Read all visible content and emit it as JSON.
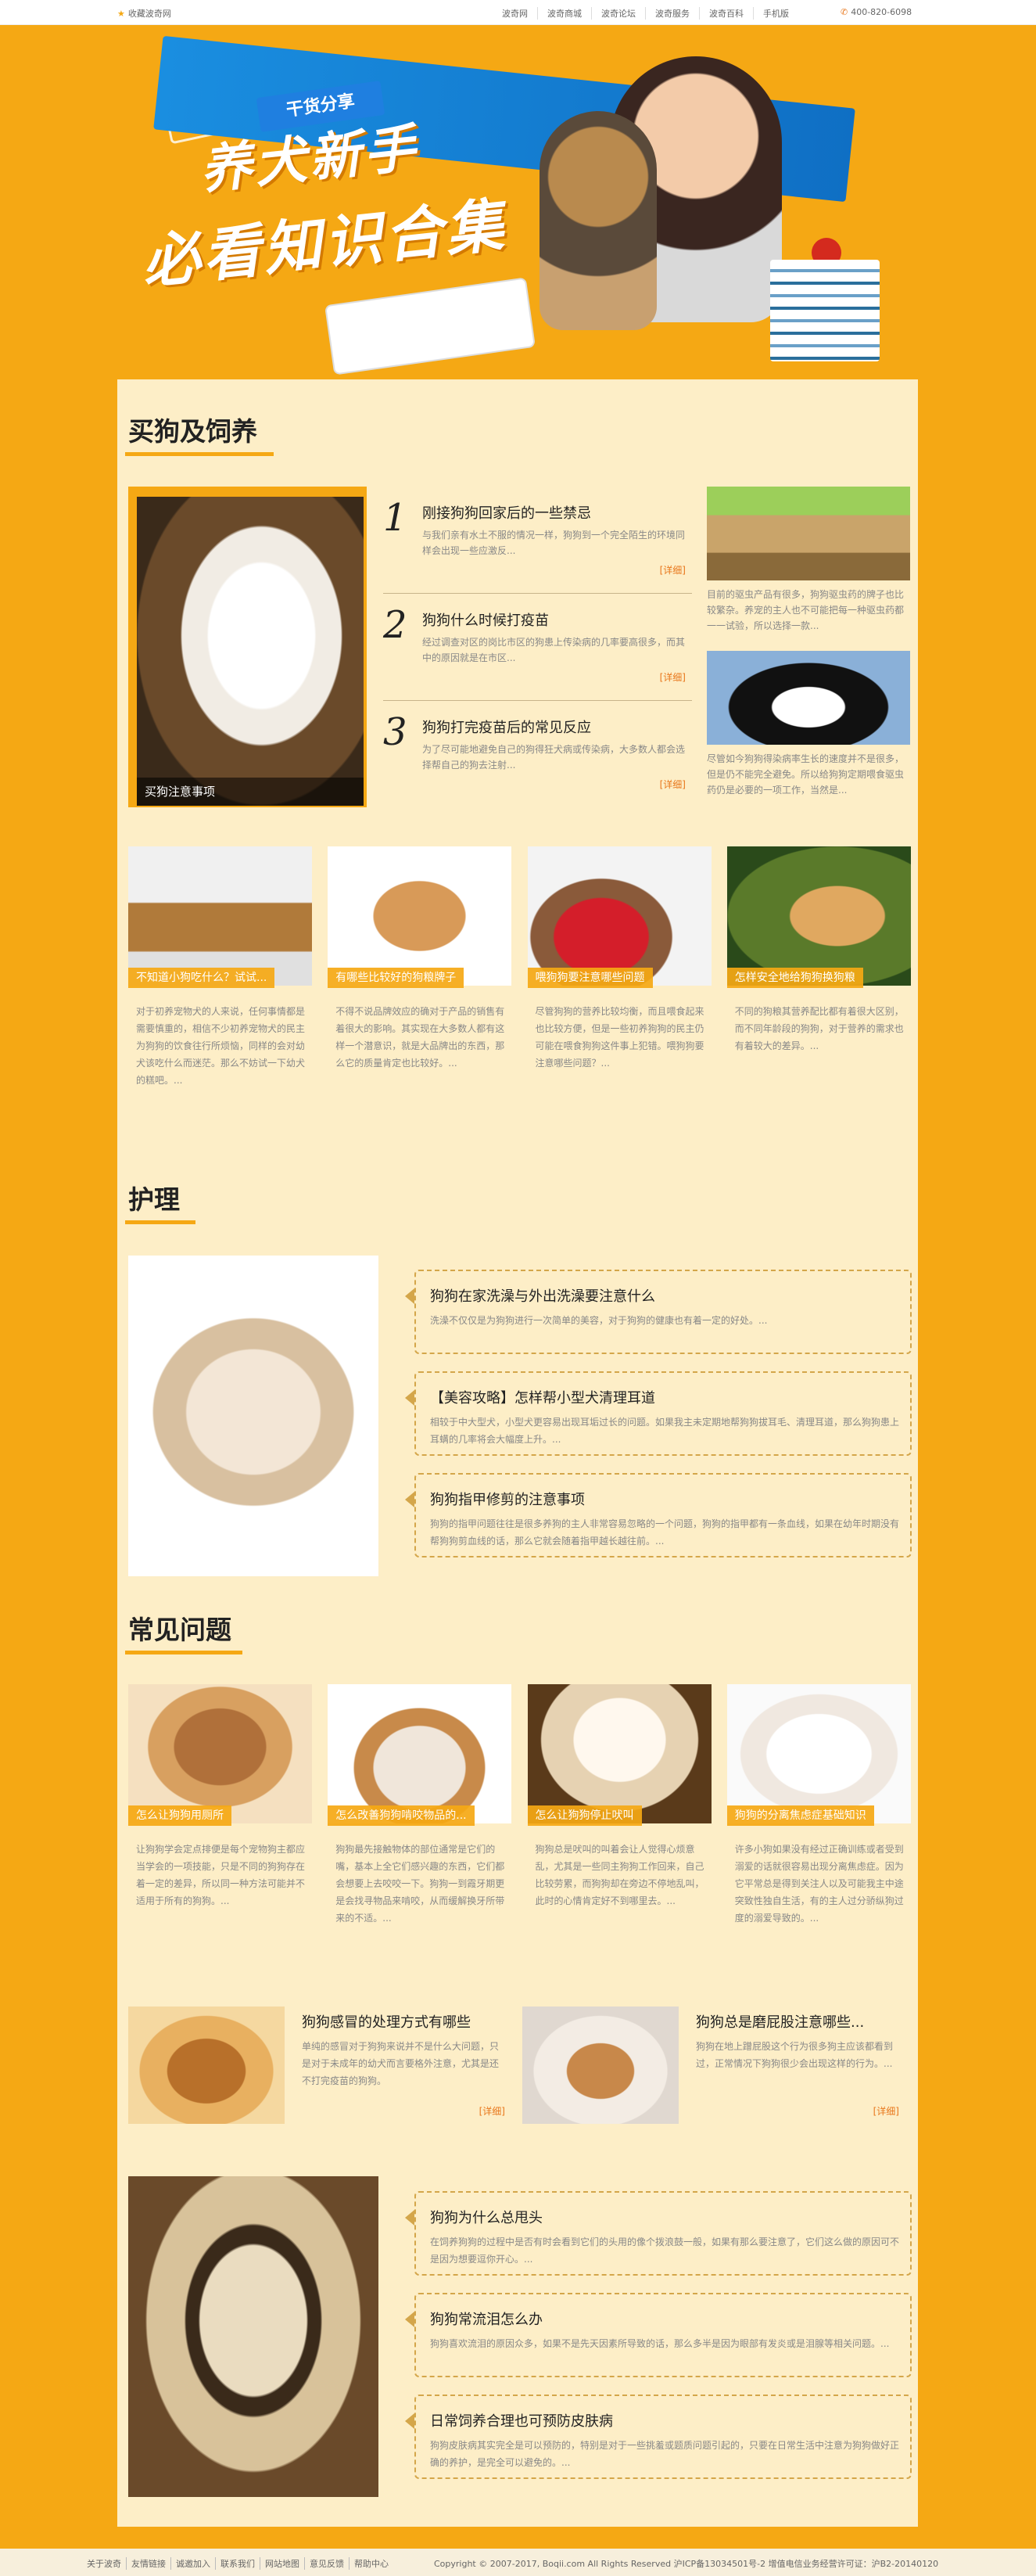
{
  "topbar": {
    "favorite": "收藏波奇网",
    "nav": [
      "波奇网",
      "波奇商城",
      "波奇论坛",
      "波奇服务",
      "波奇百科",
      "手机版"
    ],
    "phone": "400-820-6098"
  },
  "banner": {
    "tag": "干货分享",
    "title_line1": "养犬新手",
    "title_line2": "必看知识合集"
  },
  "sec1": {
    "title": "买狗及饲养",
    "feature_caption": "买狗注意事项",
    "numbered": [
      {
        "num": "1",
        "title": "刚接狗狗回家后的一些禁忌",
        "desc": "与我们亲有水土不服的情况一样，狗狗到一个完全陌生的环境同样会出现一些应激反...",
        "more": "[详细]"
      },
      {
        "num": "2",
        "title": "狗狗什么时候打疫苗",
        "desc": "经过调查对区的岗比市区的狗患上传染病的几率要高很多，而其中的原因就是在市区...",
        "more": "[详细]"
      },
      {
        "num": "3",
        "title": "狗狗打完疫苗后的常见反应",
        "desc": "为了尽可能地避免自己的狗得狂犬病或传染病，大多数人都会选择帮自己的狗去注射...",
        "more": "[详细]"
      }
    ],
    "side": [
      {
        "desc": "目前的驱虫产品有很多，狗狗驱虫药的牌子也比较繁杂。养宠的主人也不可能把每一种驱虫药都一一试验，所以选择一款..."
      },
      {
        "desc": "尽管如今狗狗得染病率生长的速度并不是很多，但是仍不能完全避免。所以给狗狗定期喂食驱虫药仍是必要的一项工作，当然是..."
      }
    ],
    "cards": [
      {
        "caption": "不知道小狗吃什么？试试...",
        "desc": "对于初养宠物犬的人来说，任何事情都是需要慎重的，相信不少初养宠物犬的民主为狗狗的饮食往行所烦恼，同样的会对幼犬该吃什么而迷茫。那么不妨试一下幼犬的糕吧。..."
      },
      {
        "caption": "有哪些比较好的狗粮牌子",
        "desc": "不得不说品牌效应的确对于产品的销售有着很大的影响。其实现在大多数人都有这样一个潜意识，就是大品牌出的东西，那么它的质量肯定也比较好。..."
      },
      {
        "caption": "喂狗狗要注意哪些问题",
        "desc": "尽管狗狗的营养比较均衡，而且喂食起来也比较方便，但是一些初养狗狗的民主仍可能在喂食狗狗这件事上犯错。喂狗狗要注意哪些问题？..."
      },
      {
        "caption": "怎样安全地给狗狗换狗粮",
        "desc": "不同的狗粮其营养配比都有着很大区别，而不同年龄段的狗狗，对于营养的需求也有着较大的差异。..."
      }
    ]
  },
  "sec2": {
    "title": "护理",
    "items": [
      {
        "title": "狗狗在家洗澡与外出洗澡要注意什么",
        "desc": "洗澡不仅仅是为狗狗进行一次简单的美容，对于狗狗的健康也有着一定的好处。..."
      },
      {
        "title": "【美容攻略】怎样帮小型犬清理耳道",
        "desc": "相较于中大型犬，小型犬更容易出现耳垢过长的问题。如果我主未定期地帮狗狗拔耳毛、清理耳道，那么狗狗患上耳螨的几率将会大幅度上升。..."
      },
      {
        "title": "狗狗指甲修剪的注意事项",
        "desc": "狗狗的指甲问题往往是很多养狗的主人非常容易忽略的一个问题，狗狗的指甲都有一条血线，如果在幼年时期没有帮狗狗剪血线的话，那么它就会随着指甲越长越往前。..."
      }
    ]
  },
  "sec3": {
    "title": "常见问题",
    "cards": [
      {
        "caption": "怎么让狗狗用厕所",
        "desc": "让狗狗学会定点排便是每个宠物狗主都应当学会的一项技能，只是不同的狗狗存在着一定的差异，所以同一种方法可能并不适用于所有的狗狗。..."
      },
      {
        "caption": "怎么改善狗狗啃咬物品的...",
        "desc": "狗狗最先接触物体的部位通常是它们的嘴，基本上全它们感兴趣的东西，它们都会想要上去咬咬一下。狗狗一到霞牙期更是会找寻物品来啃咬，从而缓解换牙所带来的不适。..."
      },
      {
        "caption": "怎么让狗狗停止吠叫",
        "desc": "狗狗总是吠叫的叫着会让人觉得心烦意乱，尤其是一些同主狗狗工作回来，自己比较劳累，而狗狗却在旁边不停地乱叫，此时的心情肯定好不到哪里去。..."
      },
      {
        "caption": "狗狗的分离焦虑症基础知识",
        "desc": "许多小狗如果没有经过正确训练或者受到溺爱的话就很容易出现分离焦虑症。因为它平常总是得到关注人以及可能我主中途突致性独自生活，有的主人过分骄纵狗过度的溺爱导致的。..."
      }
    ],
    "pair": [
      {
        "title": "狗狗感冒的处理方式有哪些",
        "desc": "单纯的感冒对于狗狗来说并不是什么大问题，只是对于未成年的幼犬而言要格外注意，尤其是还不打完疫苗的狗狗。",
        "more": "[详细]"
      },
      {
        "title": "狗狗总是磨屁股注意哪些...",
        "desc": "狗狗在地上蹭屁股这个行为很多狗主应该都看到过，正常情况下狗狗很少会出现这样的行为。...",
        "more": "[详细]"
      }
    ],
    "items": [
      {
        "title": "狗狗为什么总甩头",
        "desc": "在饲养狗狗的过程中是否有时会看到它们的头用的像个拨浪鼓一般，如果有那么要注意了，它们这么做的原因可不是因为想要逗你开心。..."
      },
      {
        "title": "狗狗常流泪怎么办",
        "desc": "狗狗喜欢流泪的原因众多，如果不是先天因素所导致的话，那么多半是因为眼部有发炎或是泪腺等相关问题。..."
      },
      {
        "title": "日常饲养合理也可预防皮肤病",
        "desc": "狗狗皮肤病其实完全是可以预防的，特别是对于一些挑羞或题质问题引起的，只要在日常生活中注意为狗狗做好正确的养护，是完全可以避免的。..."
      }
    ]
  },
  "footer": {
    "links": [
      "关于波奇",
      "友情链接",
      "诚邀加入",
      "联系我们",
      "网站地图",
      "意见反馈",
      "帮助中心"
    ],
    "copyright": "Copyright © 2007-2017, Boqii.com All Rights Reserved 沪ICP备13034501号-2 增值电信业务经营许可证：沪B2-20140120"
  },
  "colors": {
    "accent": "#f5a814",
    "panel": "#fdeec7",
    "link": "#e8761a"
  }
}
